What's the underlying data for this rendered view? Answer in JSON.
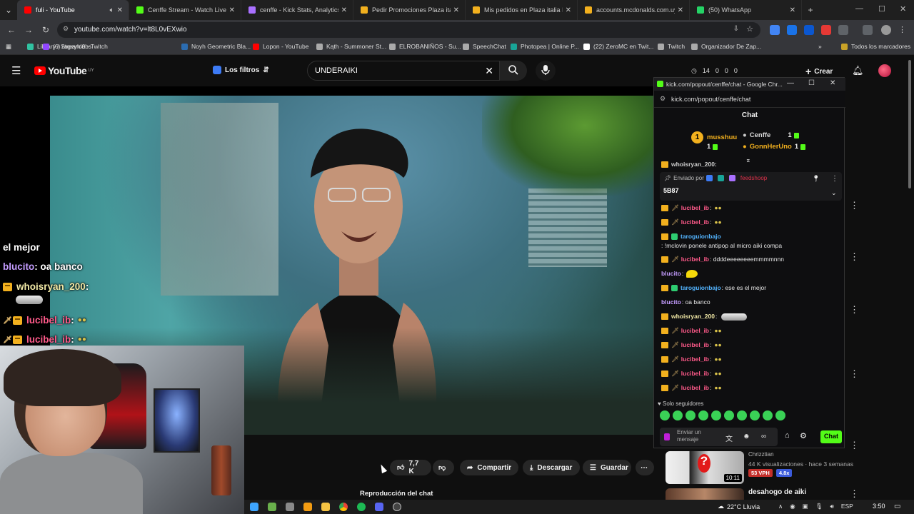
{
  "browser": {
    "tabs": [
      {
        "title": "fuli - YouTube",
        "color": "#ff0000",
        "active": true
      },
      {
        "title": "Cenffe Stream - Watch Live on Kick",
        "color": "#53fc18"
      },
      {
        "title": "cenffe - Kick Stats, Analytics and...",
        "color": "#a970ff"
      },
      {
        "title": "Pedir Promociones Plaza italia",
        "color": "#f2b01e"
      },
      {
        "title": "Mis pedidos en Plaza italia III |",
        "color": "#f2b01e"
      },
      {
        "title": "accounts.mcdonalds.com.uy/fo",
        "color": "#f2b01e"
      },
      {
        "title": "(50) WhatsApp",
        "color": "#25d366"
      }
    ],
    "new_tab": "+",
    "url": "youtube.com/watch?v=lt8L0vEXwio",
    "bookmarks": [
      {
        "label": "Library / Streamlabs",
        "color": "#31c3a2"
      },
      {
        "label": "(6) rageylo0 - Twitch",
        "color": "#9147ff"
      },
      {
        "label": "Noyh Geometric Bla...",
        "color": "#2b6cb0"
      },
      {
        "label": "Lopon - YouTube",
        "color": "#ff0000"
      },
      {
        "label": "Kąth - Summoner St...",
        "color": "#aaaaaa"
      },
      {
        "label": "ELROBANIÑOS - Su...",
        "color": "#aaaaaa"
      },
      {
        "label": "SpeechChat",
        "color": "#aaaaaa"
      },
      {
        "label": "Photopea | Online P...",
        "color": "#18a497"
      },
      {
        "label": "(22) ZeroMC en Twit...",
        "color": "#ffffff"
      },
      {
        "label": "Twitch",
        "color": "#aaaaaa"
      },
      {
        "label": "Organizador De Zap...",
        "color": "#aaaaaa"
      }
    ],
    "all_bookmarks": "Todos los marcadores"
  },
  "youtube": {
    "logo": "YouTube",
    "country": "UY",
    "filters_label": "Los filtros",
    "search_value": "UNDERAIKI",
    "counters": [
      "14",
      "0",
      "0",
      "0"
    ],
    "create_label": "Crear",
    "like_count": "7,7 K",
    "share_label": "Compartir",
    "download_label": "Descargar",
    "save_label": "Guardar",
    "chat_replay": "Reproducción del chat"
  },
  "overlay_chat": [
    {
      "user": "",
      "text": "el mejor",
      "color": "#ffffff"
    },
    {
      "user": "blucito",
      "text": " : oa banco",
      "color": "#c49cff"
    },
    {
      "user": "whoisryan_200",
      "text": " :",
      "color": "#f2e9a6"
    },
    {
      "user": "lucibel_ib",
      "text": " :",
      "color": "#ff5a8a"
    },
    {
      "user": "lucibel_ib",
      "text": " :",
      "color": "#ff5a8a"
    },
    {
      "user": "lucibel_ib",
      "text": " :",
      "color": "#ff5a8a"
    },
    {
      "user": "lucibel_ib",
      "text": " :",
      "color": "#ff5a8a"
    },
    {
      "user": "lucibel_ib",
      "text": " :",
      "color": "#ff5a8a"
    }
  ],
  "popup": {
    "window_title": "kick.com/popout/cenffe/chat - Google Chr...",
    "url": "kick.com/popout/cenffe/chat",
    "chat_title": "Chat",
    "leaders": [
      {
        "rank": "1",
        "name": "musshuu",
        "count": "1",
        "color": "#f2b01e"
      },
      {
        "rank": "",
        "name": "Cenffe",
        "count": "1",
        "color": "#dddddd"
      },
      {
        "rank": "",
        "name": "GonnHerUno",
        "count": "1",
        "color": "#f2b01e"
      }
    ],
    "pinned_by": "Enviado por",
    "pinned_user": "feedshoop",
    "pinned_text": "5B87",
    "messages": [
      {
        "user": "whoisryan_200:",
        "text": "",
        "color": "#cfcfcf"
      },
      {
        "user": "lucibel_ib",
        "text": ":",
        "color": "#ff5a8a"
      },
      {
        "user": "lucibel_ib",
        "text": ":",
        "color": "#ff5a8a"
      },
      {
        "user": "taroguionbajo",
        "text": ": !mclovin ponele antipop al micro aiki compa",
        "color": "#53b4ff"
      },
      {
        "user": "lucibel_ib",
        "text": ": ddddeeeeeeeemmmmnnn",
        "color": "#ff5a8a"
      },
      {
        "user": "blucito",
        "text": ":",
        "color": "#c49cff"
      },
      {
        "user": "taroguionbajo",
        "text": ": ese es el mejor",
        "color": "#53b4ff"
      },
      {
        "user": "blucito",
        "text": ": oa banco",
        "color": "#c49cff"
      },
      {
        "user": "whoisryan_200",
        "text": ":",
        "color": "#f2e9a6"
      },
      {
        "user": "lucibel_ib",
        "text": ":",
        "color": "#ff5a8a"
      },
      {
        "user": "lucibel_ib",
        "text": ":",
        "color": "#ff5a8a"
      },
      {
        "user": "lucibel_ib",
        "text": ":",
        "color": "#ff5a8a"
      },
      {
        "user": "lucibel_ib",
        "text": ":",
        "color": "#ff5a8a"
      },
      {
        "user": "lucibel_ib",
        "text": ":",
        "color": "#ff5a8a"
      }
    ],
    "solo": "Solo seguidores",
    "input_placeholder": "Enviar un mensaje",
    "send_label": "Chat"
  },
  "related": {
    "channel": "Chrizztian",
    "meta": "44 K visualizaciones · hace 3 semanas",
    "duration": "10:11",
    "vph": "53 VPH",
    "mult": "4.8x",
    "title2": "desahogo de aiki"
  },
  "taskbar": {
    "weather": "22°C  Lluvia",
    "lang": "ESP",
    "time": "3:50"
  }
}
